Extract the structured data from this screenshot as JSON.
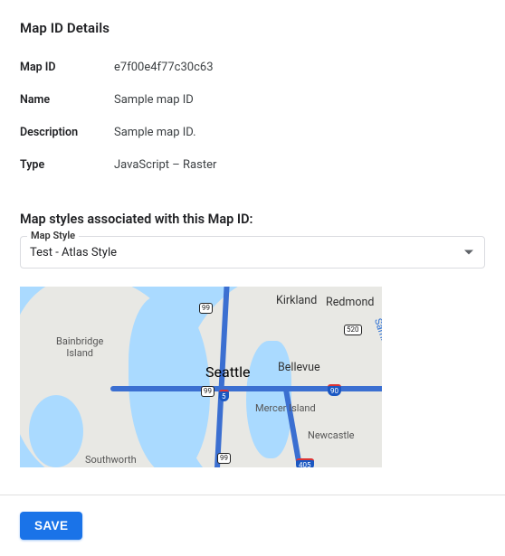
{
  "header": {
    "title": "Map ID Details"
  },
  "details": {
    "rows": [
      {
        "label": "Map ID",
        "value": "e7f00e4f77c30c63"
      },
      {
        "label": "Name",
        "value": "Sample map ID"
      },
      {
        "label": "Description",
        "value": "Sample map ID."
      },
      {
        "label": "Type",
        "value": "JavaScript – Raster"
      }
    ]
  },
  "associated": {
    "heading": "Map styles associated with this Map ID:",
    "select_label": "Map Style",
    "selected_value": "Test - Atlas Style"
  },
  "map": {
    "labels": {
      "seattle": "Seattle",
      "bellevue": "Bellevue",
      "kirkland": "Kirkland",
      "redmond": "Redmond",
      "bainbridge": "Bainbridge\nIsland",
      "mercer": "Mercer Island",
      "newcastle": "Newcastle",
      "southworth": "Southworth",
      "sammamish": "Lake Sammamish"
    },
    "shields": {
      "i5": "5",
      "i90": "90",
      "i405": "405",
      "sr99a": "99",
      "sr99b": "99",
      "sr99c": "99",
      "sr520": "520"
    }
  },
  "footer": {
    "save_label": "SAVE"
  }
}
